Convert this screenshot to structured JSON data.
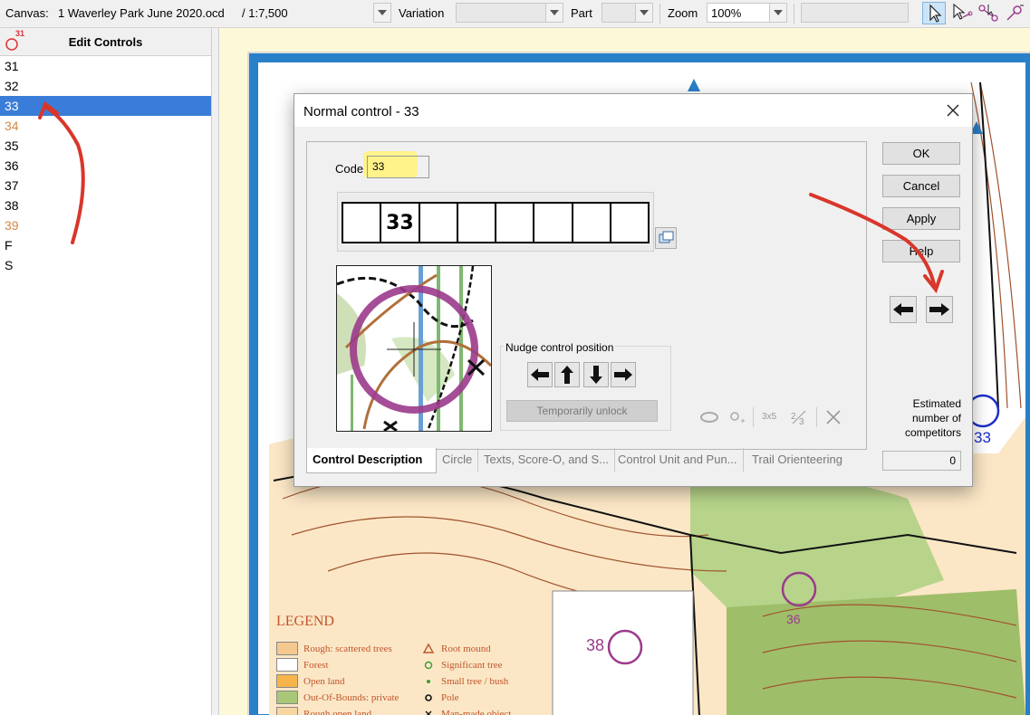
{
  "toolbar": {
    "canvas_label": "Canvas:",
    "canvas_file": "1 Waverley Park June 2020.ocd",
    "canvas_scale": "/ 1:7,500",
    "variation_label": "Variation",
    "part_label": "Part",
    "zoom_label": "Zoom",
    "zoom_value": "100%"
  },
  "left_panel": {
    "title": "Edit Controls",
    "badge": "31",
    "controls": [
      {
        "label": "31",
        "state": "normal"
      },
      {
        "label": "32",
        "state": "normal"
      },
      {
        "label": "33",
        "state": "selected"
      },
      {
        "label": "34",
        "state": "orange"
      },
      {
        "label": "35",
        "state": "normal"
      },
      {
        "label": "36",
        "state": "normal"
      },
      {
        "label": "37",
        "state": "normal"
      },
      {
        "label": "38",
        "state": "normal"
      },
      {
        "label": "39",
        "state": "orange"
      },
      {
        "label": "F",
        "state": "normal"
      },
      {
        "label": "S",
        "state": "normal"
      }
    ]
  },
  "dialog": {
    "title": "Normal control - 33",
    "code_label": "Code",
    "code_value": "33",
    "description_cells": [
      "",
      "33",
      "",
      "",
      "",
      "",
      "",
      ""
    ],
    "nudge_label": "Nudge control position",
    "unlock_label": "Temporarily unlock",
    "buttons": {
      "ok": "OK",
      "cancel": "Cancel",
      "apply": "Apply",
      "help": "Help"
    },
    "competitors_label": "Estimated number of competitors",
    "competitors_value": "0",
    "tabs": [
      "Control Description",
      "Circle",
      "Texts, Score-O, and S...",
      "Control Unit and Pun...",
      "Trail Orienteering"
    ],
    "bottom_icons": [
      "ellipse-icon",
      "circle-plus-icon",
      "3x5",
      "fraction-icon",
      "delete-x-icon"
    ]
  },
  "map": {
    "legend_title": "LEGEND",
    "legend_items": [
      {
        "label": "Rough: scattered trees",
        "color": "#f5c890"
      },
      {
        "label": "Forest",
        "color": "#ffffff"
      },
      {
        "label": "Open land",
        "color": "#f5b54a"
      },
      {
        "label": "Out-Of-Bounds: private",
        "color": "#a8c878"
      },
      {
        "label": "Rough open land",
        "color": "#f8d6a0"
      }
    ],
    "legend_symbols": [
      {
        "label": "Root mound",
        "symbol": "triangle"
      },
      {
        "label": "Significant tree",
        "symbol": "circle"
      },
      {
        "label": "Small tree / bush",
        "symbol": "dot"
      },
      {
        "label": "Pole",
        "symbol": "ring"
      },
      {
        "label": "Man-made object",
        "symbol": "x"
      }
    ],
    "control_38_label": "38",
    "control_33_label": "33",
    "control_36_label": "36"
  },
  "colors": {
    "selection": "#3a7dd8",
    "orange_control": "#d2884a",
    "control_purple": "#9b3a8c",
    "highlight_yellow": "#ffee33",
    "annotation_red": "#d9362b"
  }
}
